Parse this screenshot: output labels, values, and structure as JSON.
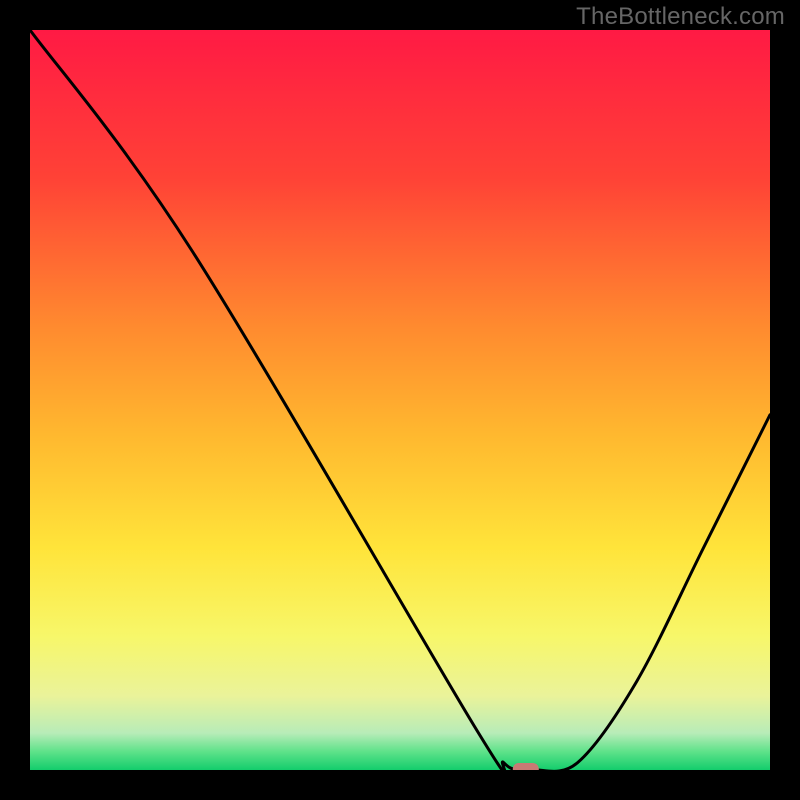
{
  "watermark": "TheBottleneck.com",
  "chart_data": {
    "type": "line",
    "title": "",
    "xlabel": "",
    "ylabel": "",
    "xlim": [
      0,
      100
    ],
    "ylim": [
      0,
      100
    ],
    "series": [
      {
        "name": "curve",
        "x": [
          0,
          22,
          60,
          64,
          66,
          68,
          74,
          82,
          91,
          100
        ],
        "values": [
          100,
          70,
          6,
          1,
          0,
          0,
          1,
          12,
          30,
          48
        ]
      }
    ],
    "marker": {
      "x": 67,
      "y": 0
    },
    "gradient_stops": [
      {
        "offset": 0.0,
        "color": "#ff1a44"
      },
      {
        "offset": 0.2,
        "color": "#ff4236"
      },
      {
        "offset": 0.4,
        "color": "#ff8a2f"
      },
      {
        "offset": 0.55,
        "color": "#ffb92f"
      },
      {
        "offset": 0.7,
        "color": "#ffe43a"
      },
      {
        "offset": 0.82,
        "color": "#f7f76a"
      },
      {
        "offset": 0.9,
        "color": "#eaf39a"
      },
      {
        "offset": 0.95,
        "color": "#b8ecb8"
      },
      {
        "offset": 0.975,
        "color": "#5fe28a"
      },
      {
        "offset": 1.0,
        "color": "#13cd6c"
      }
    ],
    "marker_color": "#c87a74"
  }
}
